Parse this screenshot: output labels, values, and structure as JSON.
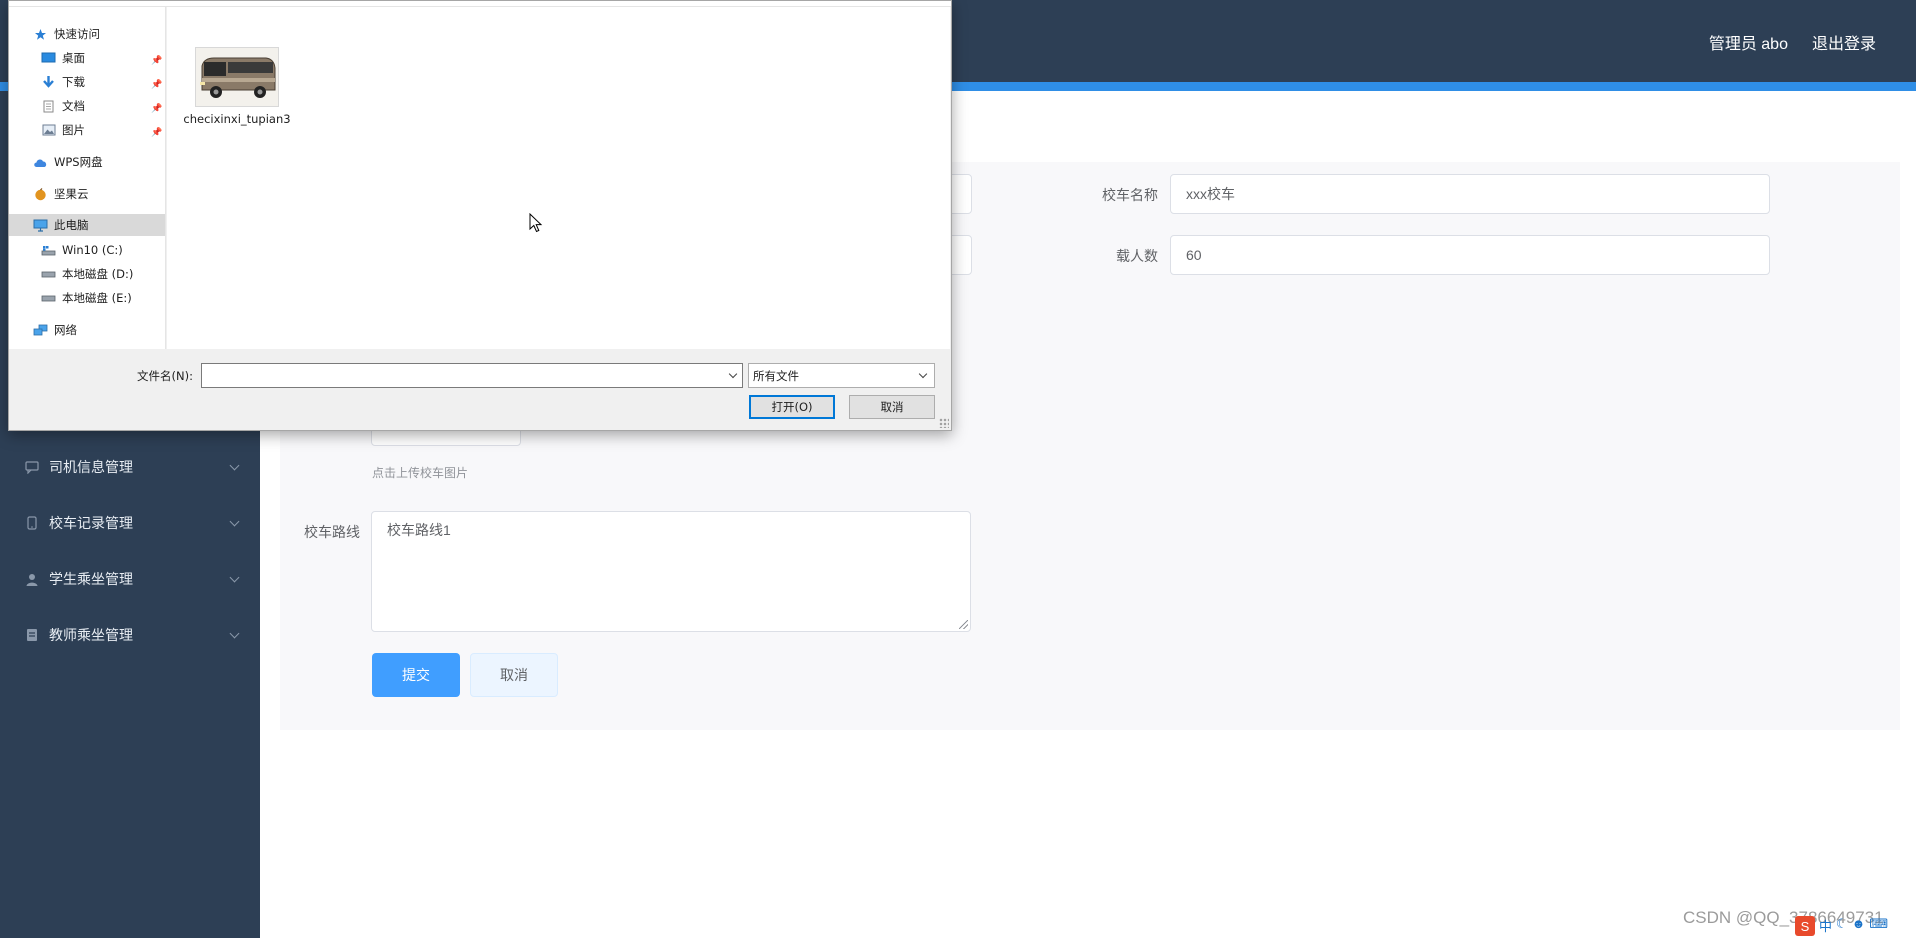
{
  "header": {
    "user_label": "管理员 abo",
    "logout_label": "退出登录"
  },
  "sidebar": {
    "items": [
      {
        "label": "司机信息管理",
        "icon": "chat-icon"
      },
      {
        "label": "校车记录管理",
        "icon": "phone-icon"
      },
      {
        "label": "学生乘坐管理",
        "icon": "user-icon"
      },
      {
        "label": "教师乘坐管理",
        "icon": "document-icon"
      }
    ]
  },
  "form": {
    "bus_name_label": "校车名称",
    "bus_name_value": "xxx校车",
    "capacity_label": "载人数",
    "capacity_value": "60",
    "upload_tip": "点击上传校车图片",
    "route_label": "校车路线",
    "route_value": "校车路线1",
    "submit_label": "提交",
    "cancel_label": "取消"
  },
  "file_dialog": {
    "nav": [
      {
        "label": "快速访问",
        "icon": "star-icon",
        "pinned": false
      },
      {
        "label": "桌面",
        "icon": "desktop-icon",
        "pinned": true
      },
      {
        "label": "下载",
        "icon": "download-icon",
        "pinned": true
      },
      {
        "label": "文档",
        "icon": "document-icon",
        "pinned": true
      },
      {
        "label": "图片",
        "icon": "pictures-icon",
        "pinned": true
      },
      {
        "label": "WPS网盘",
        "icon": "cloud-icon",
        "pinned": false
      },
      {
        "label": "坚果云",
        "icon": "nut-cloud-icon",
        "pinned": false
      },
      {
        "label": "此电脑",
        "icon": "computer-icon",
        "pinned": false,
        "selected": true
      },
      {
        "label": "Win10 (C:)",
        "icon": "drive-c-icon",
        "pinned": false
      },
      {
        "label": "本地磁盘 (D:)",
        "icon": "drive-icon",
        "pinned": false
      },
      {
        "label": "本地磁盘 (E:)",
        "icon": "drive-icon",
        "pinned": false
      },
      {
        "label": "网络",
        "icon": "network-icon",
        "pinned": false
      }
    ],
    "file_name": "checixinxi_tupian3",
    "filename_label": "文件名(N):",
    "filename_value": "",
    "filetype_value": "所有文件",
    "open_label": "打开(O)",
    "cancel_label": "取消"
  },
  "watermark": "CSDN @QQ_3786649731",
  "tray": {
    "ime_label": "中"
  }
}
